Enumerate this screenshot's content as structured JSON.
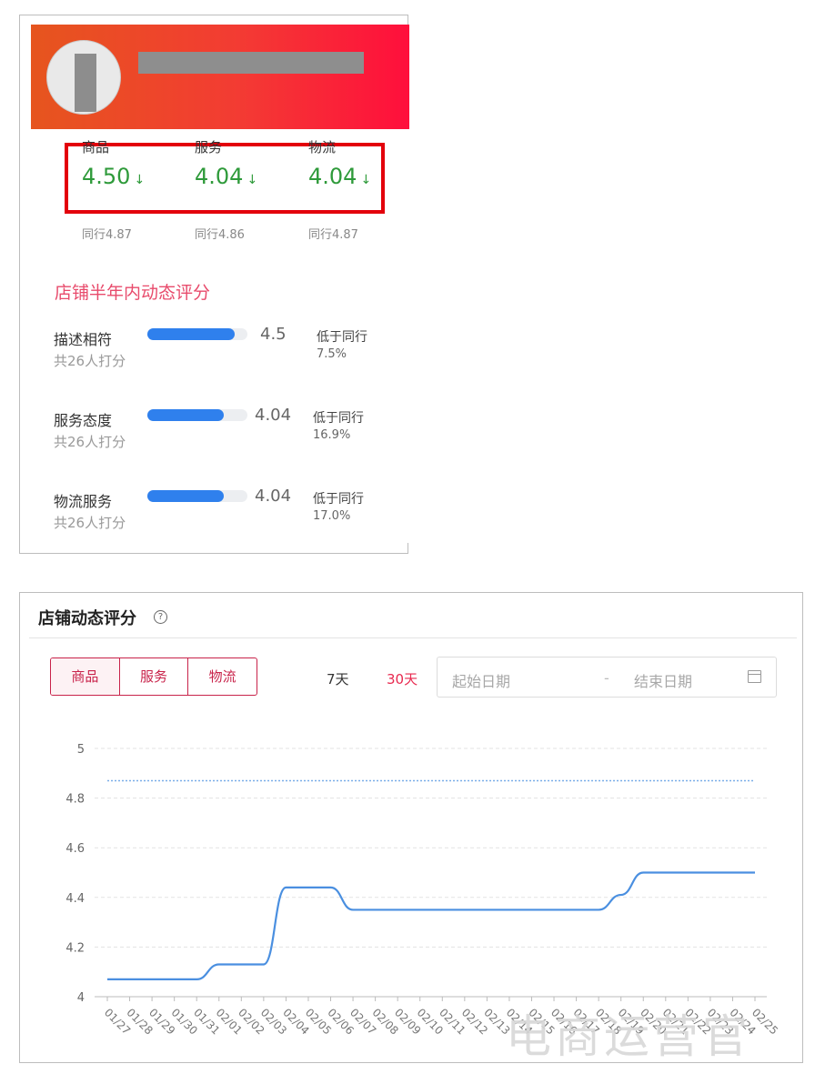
{
  "shop_card": {
    "metrics": [
      {
        "label": "商品",
        "value": "4.50",
        "arrow": "↓",
        "peer": "同行4.87"
      },
      {
        "label": "服务",
        "value": "4.04",
        "arrow": "↓",
        "peer": "同行4.86"
      },
      {
        "label": "物流",
        "value": "4.04",
        "arrow": "↓",
        "peer": "同行4.87"
      }
    ],
    "dynamic_title": "店铺半年内动态评分",
    "rows": [
      {
        "name": "描述相符",
        "count": "共26人打分",
        "score": "4.5",
        "fill": 0.87,
        "compare": "低于同行",
        "pct": "7.5%"
      },
      {
        "name": "服务态度",
        "count": "共26人打分",
        "score": "4.04",
        "fill": 0.76,
        "compare": "低于同行",
        "pct": "16.9%"
      },
      {
        "name": "物流服务",
        "count": "共26人打分",
        "score": "4.04",
        "fill": 0.76,
        "compare": "低于同行",
        "pct": "17.0%"
      }
    ],
    "colors": {
      "banner_start": "#e6551e",
      "banner_end": "#ff0f3c",
      "score_green": "#2e9a3a",
      "bar_blue": "#2f80ed",
      "highlight_red": "#e3000b"
    }
  },
  "chart_card": {
    "title": "店铺动态评分",
    "help_icon": "?",
    "tabs": [
      "商品",
      "服务",
      "物流"
    ],
    "active_tab": "商品",
    "ranges": [
      "7天",
      "30天"
    ],
    "active_range": "30天",
    "date_start_placeholder": "起始日期",
    "date_separator": "-",
    "date_end_placeholder": "结束日期",
    "calendar_icon": "calendar-icon"
  },
  "chart_data": {
    "type": "line",
    "ylim": [
      4,
      5
    ],
    "yticks": [
      "4",
      "4.2",
      "4.4",
      "4.6",
      "4.8",
      "5"
    ],
    "x": [
      "01/27",
      "01/28",
      "01/29",
      "01/30",
      "01/31",
      "02/01",
      "02/02",
      "02/03",
      "02/04",
      "02/05",
      "02/06",
      "02/07",
      "02/08",
      "02/09",
      "02/10",
      "02/11",
      "02/12",
      "02/13",
      "02/14",
      "02/15",
      "02/16",
      "02/17",
      "02/18",
      "02/19",
      "02/20",
      "02/21",
      "02/22",
      "02/23",
      "02/24",
      "02/25"
    ],
    "series": [
      {
        "values": [
          4.07,
          4.07,
          4.07,
          4.07,
          4.07,
          4.13,
          4.13,
          4.13,
          4.44,
          4.44,
          4.44,
          4.35,
          4.35,
          4.35,
          4.35,
          4.35,
          4.35,
          4.35,
          4.35,
          4.35,
          4.35,
          4.35,
          4.35,
          4.41,
          4.5,
          4.5,
          4.5,
          4.5,
          4.5,
          4.5
        ],
        "color": "#4a8fe0"
      },
      {
        "values": [
          4.87,
          4.87,
          4.87,
          4.87,
          4.87,
          4.87,
          4.87,
          4.87,
          4.87,
          4.87,
          4.87,
          4.87,
          4.87,
          4.87,
          4.87,
          4.87,
          4.87,
          4.87,
          4.87,
          4.87,
          4.87,
          4.87,
          4.87,
          4.87,
          4.87,
          4.87,
          4.87,
          4.87,
          4.87,
          4.87
        ],
        "color": "#7aaee8",
        "style": "dotted"
      }
    ],
    "grid": true,
    "x_tick_rotation": "45deg"
  },
  "watermark": "电商运营官"
}
